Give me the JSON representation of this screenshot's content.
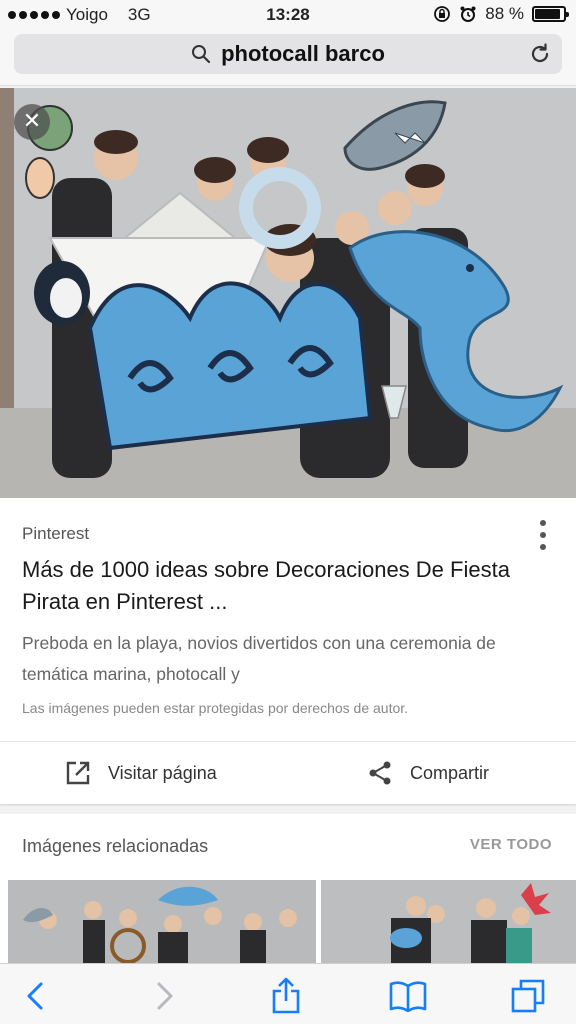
{
  "status_bar": {
    "carrier": "Yoigo",
    "network": "3G",
    "time": "13:28",
    "battery_percent": "88 %",
    "battery_level": 0.88
  },
  "url_bar": {
    "query": "photocall barco"
  },
  "result": {
    "source": "Pinterest",
    "title": "Más de 1000 ideas sobre Decoraciones De Fiesta Pirata en Pinterest ...",
    "description": "Preboda en la playa, novios divertidos con una ceremonia de temática marina, photocall y",
    "copyright_notice": "Las imágenes pueden estar protegidas por derechos de autor.",
    "visit_label": "Visitar página",
    "share_label": "Compartir"
  },
  "related": {
    "title": "Imágenes relacionadas",
    "view_all": "VER TODO"
  },
  "colors": {
    "ios_blue": "#147efb",
    "photo_backdrop": "#c9cbcc",
    "prop_blue": "#5aa3d6"
  },
  "icons": {
    "search": "search-icon",
    "reload": "reload-icon",
    "close": "close-icon",
    "more": "more-vert-icon",
    "external_link": "external-link-icon",
    "share": "share-icon",
    "back": "chevron-left-icon",
    "forward": "chevron-right-icon",
    "share_toolbar": "share-toolbar-icon",
    "bookmarks": "book-icon",
    "tabs": "tabs-icon"
  }
}
